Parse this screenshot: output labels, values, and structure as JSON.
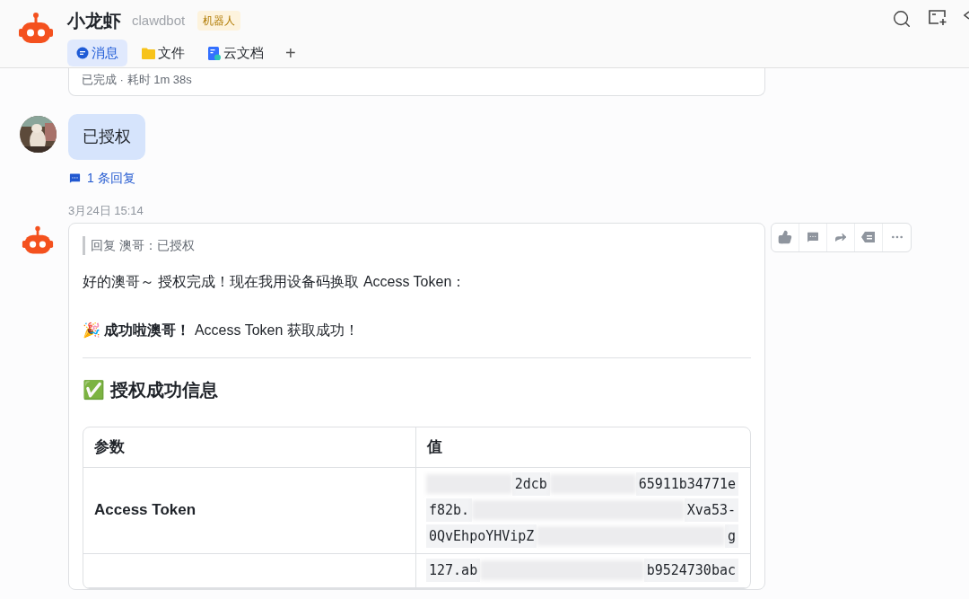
{
  "header": {
    "title": "小龙虾",
    "handle": "clawdbot",
    "badge": "机器人",
    "tabs": [
      {
        "label": "消息",
        "kind": "chat",
        "selected": true
      },
      {
        "label": "文件",
        "kind": "folder",
        "selected": false
      },
      {
        "label": "云文档",
        "kind": "doc",
        "selected": false
      }
    ],
    "add_label": "+"
  },
  "previous_card": {
    "status": "已完成 · 耗时 1m 38s"
  },
  "user_message": {
    "text": "已授权",
    "replies": "1 条回复"
  },
  "timestamp": "3月24日 15:14",
  "bot_message": {
    "quote": "回复 澳哥：已授权",
    "intro": "好的澳哥～ 授权完成！现在我用设备码换取 Access Token：",
    "success": "🎉 **成功啦澳哥！** Access Token 获取成功！",
    "heading": "✅ 授权成功信息",
    "table": {
      "columns": [
        "参数",
        "值"
      ],
      "rows": [
        {
          "name": "Access Token",
          "lines": [
            [
              {
                "kind": "redacted"
              },
              {
                "kind": "text",
                "text": "2dcb"
              },
              {
                "kind": "redacted"
              },
              {
                "kind": "text",
                "text": "65911b34771e"
              }
            ],
            [
              {
                "kind": "text",
                "text": "f82b."
              },
              {
                "kind": "redacted"
              },
              {
                "kind": "text",
                "text": "Xva53-"
              }
            ],
            [
              {
                "kind": "text",
                "text": "0QvEhpoYHVipZ"
              },
              {
                "kind": "redacted"
              },
              {
                "kind": "text",
                "text": "g"
              }
            ]
          ]
        },
        {
          "lines": [
            [
              {
                "kind": "text",
                "text": "127.ab"
              },
              {
                "kind": "redacted"
              },
              {
                "kind": "text",
                "text": "b9524730bac"
              }
            ]
          ]
        }
      ]
    }
  }
}
